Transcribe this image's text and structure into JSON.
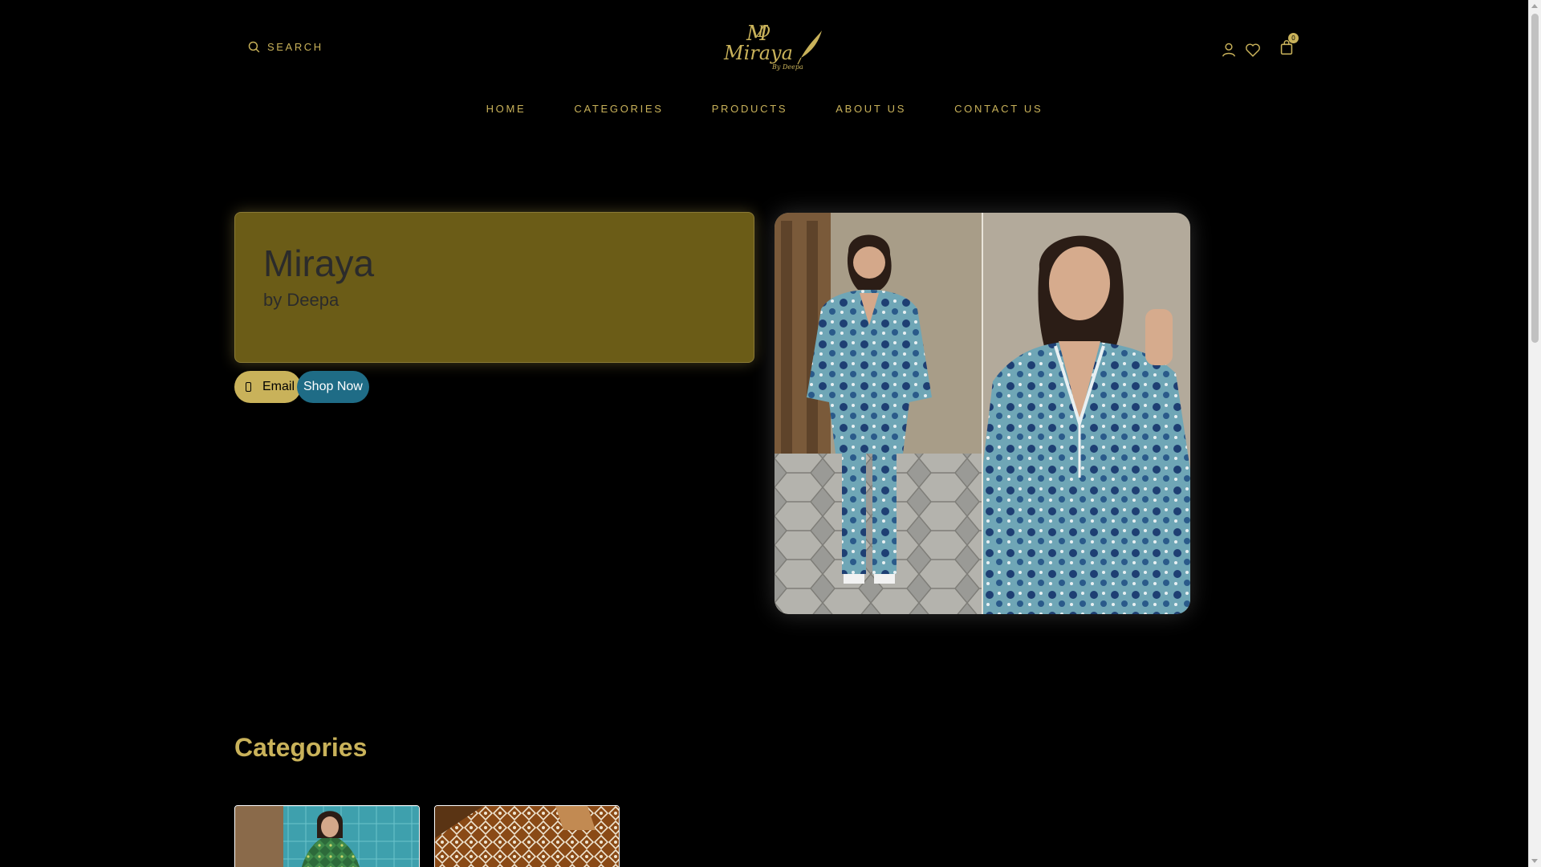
{
  "header": {
    "search_label": "SEARCH",
    "logo_alt": "Miraya By Deepa",
    "cart_count": "0"
  },
  "nav": {
    "items": [
      {
        "label": "HOME"
      },
      {
        "label": "CATEGORIES"
      },
      {
        "label": "PRODUCTS"
      },
      {
        "label": "ABOUT US"
      },
      {
        "label": "CONTACT US"
      }
    ]
  },
  "hero": {
    "title": "Miraya",
    "subtitle": "by Deepa",
    "email_button": "Email",
    "shop_button": "Shop Now"
  },
  "categories": {
    "heading": "Categories",
    "items": [
      {
        "name": "category-green-kaftan"
      },
      {
        "name": "category-brown-print"
      }
    ]
  },
  "icons": {
    "search": "search-icon",
    "user": "user-icon",
    "wishlist": "heart-icon",
    "cart": "shopping-bag-icon",
    "email": "phone-icon"
  },
  "colors": {
    "background": "#000000",
    "accent_gold": "#c9b25a",
    "hero_card": "#6b5c17",
    "shop_button": "#1f6c86",
    "text_dark": "#2b2b2b"
  }
}
